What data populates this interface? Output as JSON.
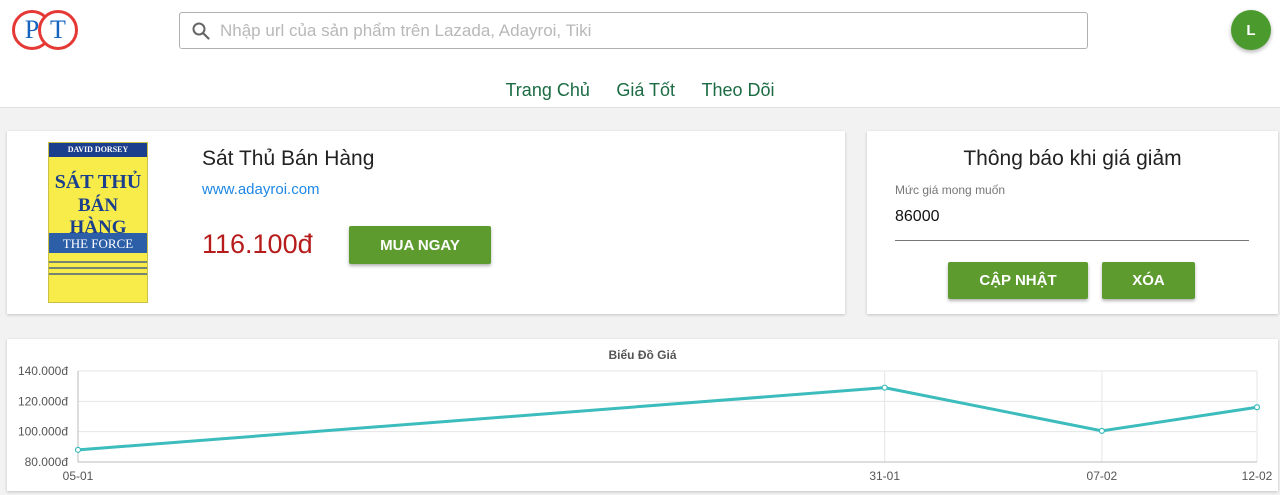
{
  "header": {
    "logo_letters": [
      "P",
      "T"
    ],
    "search_placeholder": "Nhập url của sản phẩm trên Lazada, Adayroi, Tiki",
    "avatar_initial": "L",
    "avatar_color": "#4a9a2e"
  },
  "nav": {
    "items": [
      {
        "label": "Trang Chủ"
      },
      {
        "label": "Giá Tốt"
      },
      {
        "label": "Theo Dõi"
      }
    ]
  },
  "product": {
    "cover": {
      "author": "DAVID DORSEY",
      "title_line1": "SÁT THỦ",
      "title_line2": "BÁN HÀNG",
      "subtitle": "THE FORCE"
    },
    "name": "Sát Thủ Bán Hàng",
    "source": "www.adayroi.com",
    "price": "116.100đ",
    "buy_label": "MUA NGAY"
  },
  "notify": {
    "title": "Thông báo khi giá giảm",
    "field_label": "Mức giá mong muốn",
    "field_value": "86000",
    "update_label": "CẬP NHẬT",
    "delete_label": "XÓA"
  },
  "colors": {
    "accent_green": "#5d9b2f",
    "nav_green": "#1b6b43",
    "price_red": "#b71c1c",
    "link_blue": "#1e88e5",
    "line": "#3cbcbc"
  },
  "chart_data": {
    "type": "line",
    "title": "Biểu Đồ Giá",
    "categories": [
      "05-01",
      "31-01",
      "07-02",
      "12-02"
    ],
    "x_days": [
      0,
      26,
      33,
      38
    ],
    "series": [
      {
        "values": [
          88000,
          129000,
          100500,
          116100
        ]
      }
    ],
    "ylim": [
      80000,
      140000
    ],
    "yticks": [
      "80.000đ",
      "100.000đ",
      "120.000đ",
      "140.000đ"
    ],
    "ytick_values": [
      80000,
      100000,
      120000,
      140000
    ],
    "grid": true
  }
}
